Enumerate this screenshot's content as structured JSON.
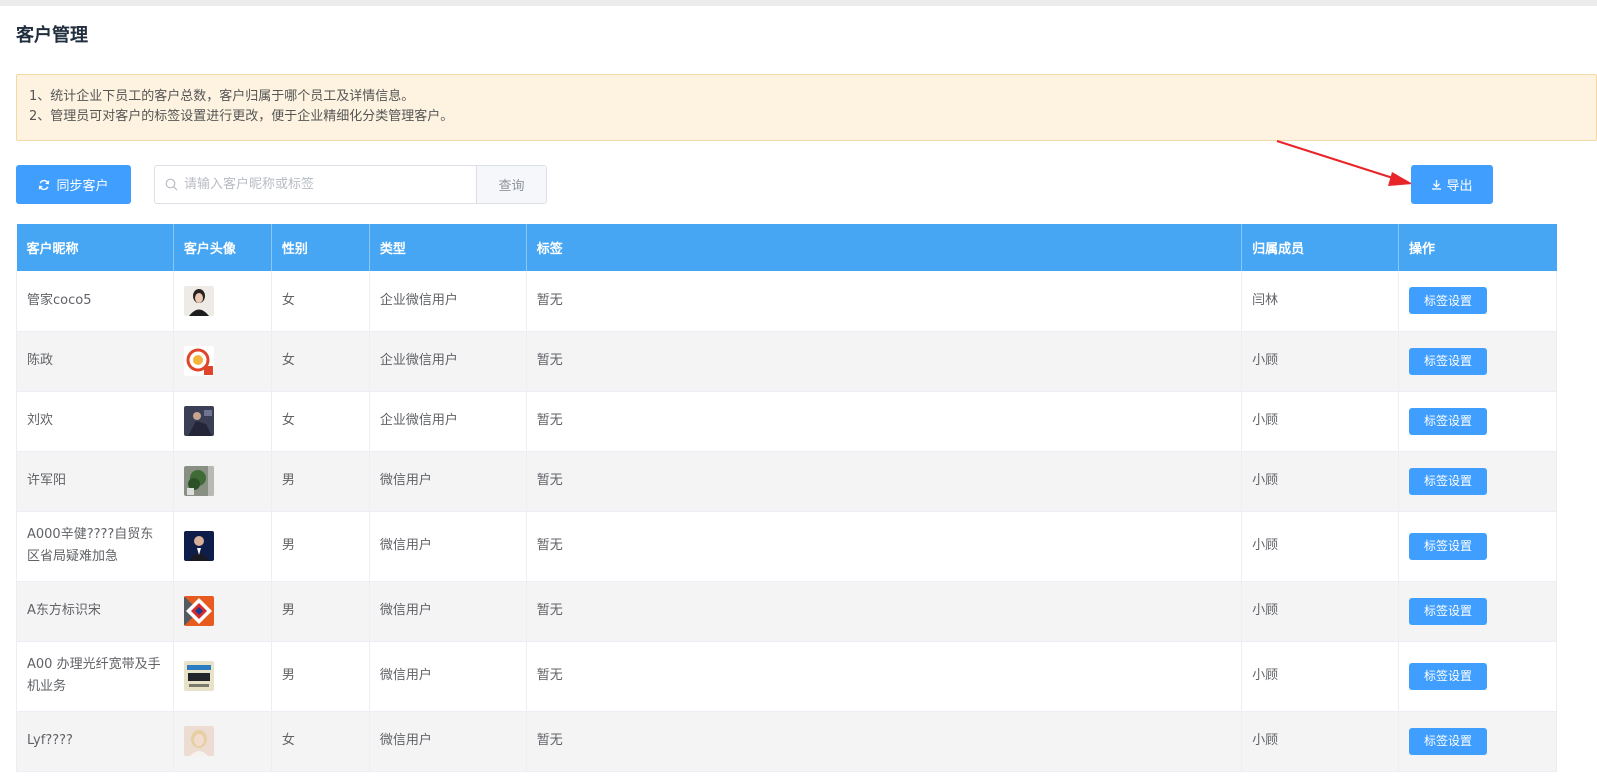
{
  "page": {
    "title": "客户管理"
  },
  "notice": {
    "line1": "1、统计企业下员工的客户总数，客户归属于哪个员工及详情信息。",
    "line2": "2、管理员可对客户的标签设置进行更改，便于企业精细化分类管理客户。"
  },
  "toolbar": {
    "sync_label": "同步客户",
    "search_placeholder": "请输入客户昵称或标签",
    "search_value": "",
    "query_label": "查询",
    "export_label": "导出"
  },
  "colors": {
    "primary": "#409eff",
    "header": "#46a6f3",
    "notice_bg": "#fdf3e0",
    "arrow": "#e8262a"
  },
  "table": {
    "columns": [
      "客户昵称",
      "客户头像",
      "性别",
      "类型",
      "标签",
      "归属成员",
      "操作"
    ],
    "action_label": "标签设置",
    "rows": [
      {
        "nickname": "管家coco5",
        "avatar": "avatar-woman-portrait",
        "gender": "女",
        "type": "企业微信用户",
        "tag": "暂无",
        "owner": "闫林"
      },
      {
        "nickname": "陈政",
        "avatar": "avatar-cartoon-logo",
        "gender": "女",
        "type": "企业微信用户",
        "tag": "暂无",
        "owner": "小顾"
      },
      {
        "nickname": "刘欢",
        "avatar": "avatar-dark-photo",
        "gender": "女",
        "type": "企业微信用户",
        "tag": "暂无",
        "owner": "小顾"
      },
      {
        "nickname": "许军阳",
        "avatar": "avatar-plant-photo",
        "gender": "男",
        "type": "微信用户",
        "tag": "暂无",
        "owner": "小顾"
      },
      {
        "nickname": "A000辛健????自贸东区省局疑难加急",
        "avatar": "avatar-man-suit",
        "gender": "男",
        "type": "微信用户",
        "tag": "暂无",
        "owner": "小顾"
      },
      {
        "nickname": "A东方标识宋",
        "avatar": "avatar-diamond-logo",
        "gender": "男",
        "type": "微信用户",
        "tag": "暂无",
        "owner": "小顾"
      },
      {
        "nickname": "A00 办理光纤宽带及手机业务",
        "avatar": "avatar-ad-card",
        "gender": "男",
        "type": "微信用户",
        "tag": "暂无",
        "owner": "小顾"
      },
      {
        "nickname": "Lyf????",
        "avatar": "avatar-blonde-portrait",
        "gender": "女",
        "type": "微信用户",
        "tag": "暂无",
        "owner": "小顾"
      }
    ]
  }
}
